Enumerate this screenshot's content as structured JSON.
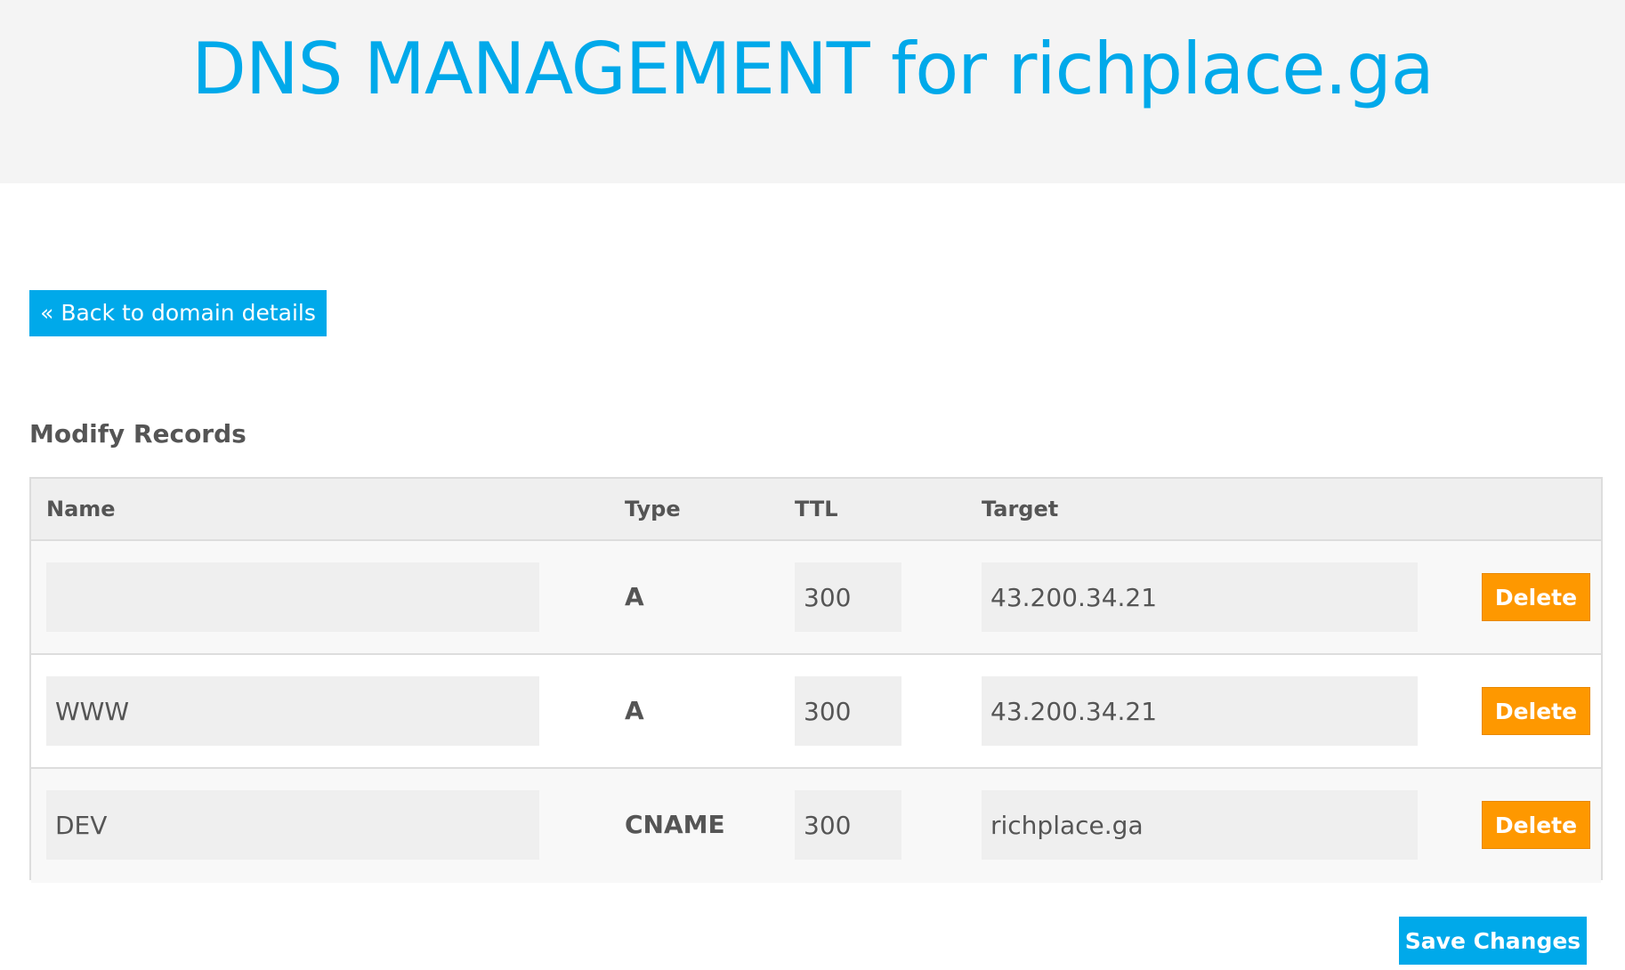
{
  "header": {
    "title": "DNS MANAGEMENT for richplace.ga"
  },
  "back_button": {
    "label": "« Back to domain details"
  },
  "section_title": "Modify Records",
  "table": {
    "columns": [
      "Name",
      "Type",
      "TTL",
      "Target"
    ],
    "rows": [
      {
        "name": "",
        "type": "A",
        "ttl": "300",
        "target": "43.200.34.21",
        "delete_label": "Delete"
      },
      {
        "name": "WWW",
        "type": "A",
        "ttl": "300",
        "target": "43.200.34.21",
        "delete_label": "Delete"
      },
      {
        "name": "DEV",
        "type": "CNAME",
        "ttl": "300",
        "target": "richplace.ga",
        "delete_label": "Delete"
      }
    ]
  },
  "save_button": {
    "label": "Save Changes"
  },
  "colors": {
    "accent": "#00a9ea",
    "delete": "#fe9800",
    "header_bg": "#f4f4f4",
    "field_bg": "#efefef",
    "text": "#555555"
  }
}
